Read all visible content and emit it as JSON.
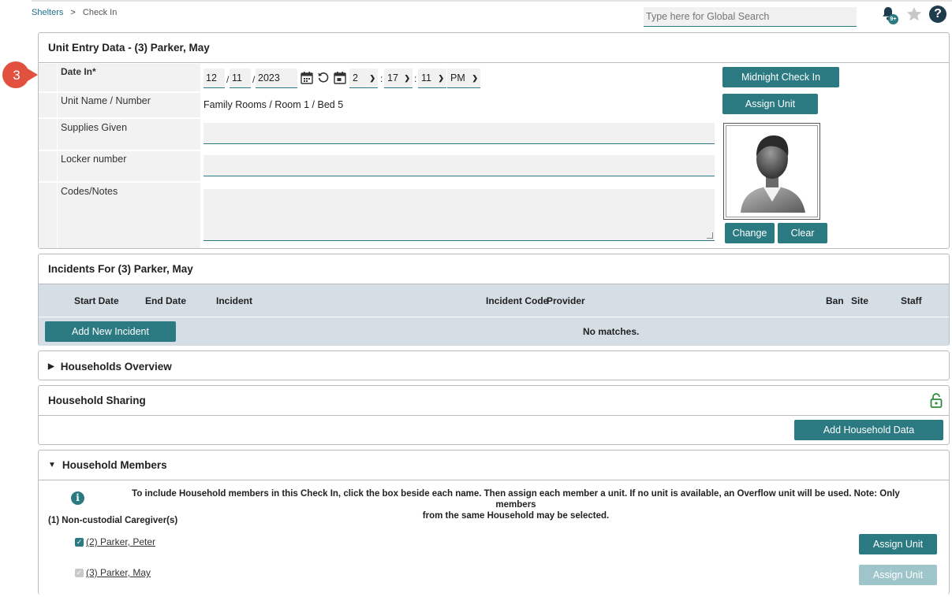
{
  "breadcrumb": {
    "parent": "Shelters",
    "separator": ">",
    "current": "Check In"
  },
  "search": {
    "placeholder": "Type here for Global Search"
  },
  "notifications": {
    "badge": "9+"
  },
  "help_label": "?",
  "step_marker": "3",
  "unit_entry": {
    "title": "Unit Entry Data - (3) Parker, May",
    "labels": {
      "date_in": "Date In",
      "required_mark": "*",
      "unit_name": "Unit Name / Number",
      "supplies": "Supplies Given",
      "locker": "Locker number",
      "codes": "Codes/Notes"
    },
    "date": {
      "month": "12",
      "day": "11",
      "year": "2023",
      "sep": "/"
    },
    "time": {
      "hour": "2",
      "minute": "17",
      "second": "11",
      "ampm": "PM",
      "sep": ":"
    },
    "unit_value": "Family Rooms / Room 1 / Bed 5",
    "buttons": {
      "midnight": "Midnight Check In",
      "assign_unit": "Assign Unit",
      "change": "Change",
      "clear": "Clear"
    }
  },
  "incidents": {
    "title": "Incidents For (3) Parker, May",
    "columns": [
      "Start Date",
      "End Date",
      "Incident",
      "Incident Code",
      "Provider",
      "Ban",
      "Site",
      "Staff"
    ],
    "add_button": "Add New Incident",
    "empty_text": "No matches."
  },
  "households_overview": {
    "title": "Households Overview"
  },
  "household_sharing": {
    "title": "Household Sharing",
    "add_button": "Add Household Data"
  },
  "household_members": {
    "title": "Household Members",
    "info_line1": "To include Household members in this Check In, click the box beside each name. Then assign each member a unit. If no unit is available, an Overflow unit will be used. Note: Only members",
    "info_line2": "from the same Household may be selected.",
    "group_label": "(1) Non-custodial Caregiver(s)",
    "members": [
      {
        "name": "(2) Parker, Peter",
        "assign": "Assign Unit"
      },
      {
        "name": "(3) Parker, May",
        "assign": "Assign Unit"
      }
    ]
  },
  "colors": {
    "accent": "#2b7a82",
    "accent_disabled": "#9ec5c9",
    "header_bg": "#d5dde5",
    "step_badge": "#e2513f"
  }
}
